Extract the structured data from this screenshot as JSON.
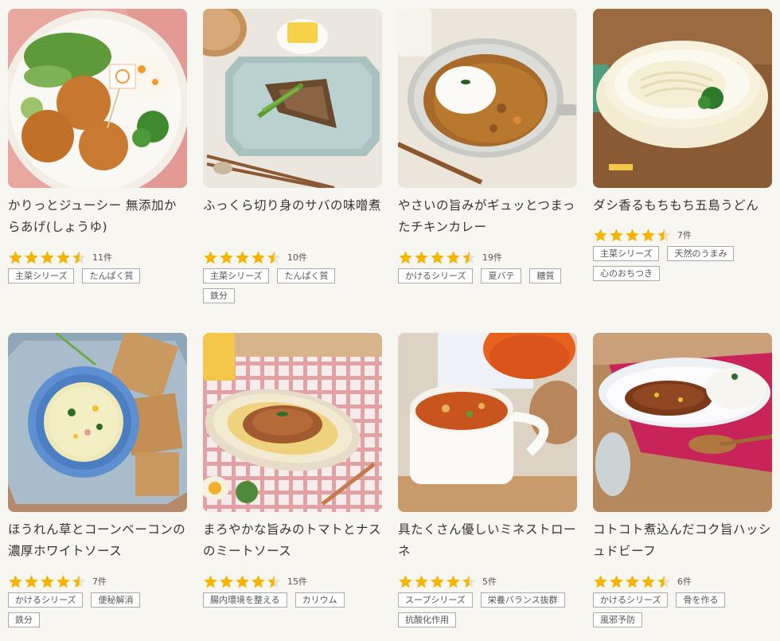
{
  "products": [
    {
      "title": "かりっとジューシー 無添加からあげ(しょうゆ)",
      "rating": 4.5,
      "count": "11件",
      "tags": [
        "主菜シリーズ",
        "たんぱく質"
      ],
      "photo": "karaage"
    },
    {
      "title": "ふっくら切り身のサバの味噌煮",
      "rating": 4.5,
      "count": "10件",
      "tags": [
        "主菜シリーズ",
        "たんぱく質",
        "鉄分"
      ],
      "photo": "saba"
    },
    {
      "title": "やさいの旨みがギュッとつまったチキンカレー",
      "rating": 4.5,
      "count": "19件",
      "tags": [
        "かけるシリーズ",
        "夏バテ",
        "糖質"
      ],
      "photo": "curry"
    },
    {
      "title": "ダシ香るもちもち五島うどん",
      "rating": 4.5,
      "count": "7件",
      "tags": [
        "主菜シリーズ",
        "天然のうまみ",
        "心のおちつき"
      ],
      "photo": "udon"
    },
    {
      "title": "ほうれん草とコーンベーコンの濃厚ホワイトソース",
      "rating": 4.5,
      "count": "7件",
      "tags": [
        "かけるシリーズ",
        "便秘解消",
        "鉄分"
      ],
      "photo": "white"
    },
    {
      "title": "まろやかな旨みのトマトとナスのミートソース",
      "rating": 4.5,
      "count": "15件",
      "tags": [
        "腸内環境を整える",
        "カリウム"
      ],
      "photo": "meat"
    },
    {
      "title": "具たくさん優しいミネストローネ",
      "rating": 4.5,
      "count": "5件",
      "tags": [
        "スープシリーズ",
        "栄養バランス抜群",
        "抗酸化作用"
      ],
      "photo": "mine"
    },
    {
      "title": "コトコト煮込んだコク旨ハッシュドビーフ",
      "rating": 4.5,
      "count": "6件",
      "tags": [
        "かけるシリーズ",
        "骨を作る",
        "風邪予防"
      ],
      "photo": "beef"
    }
  ],
  "colors": {
    "star": "#f5b400",
    "star_empty": "#e8e2d4",
    "background": "#f8f6f1"
  }
}
